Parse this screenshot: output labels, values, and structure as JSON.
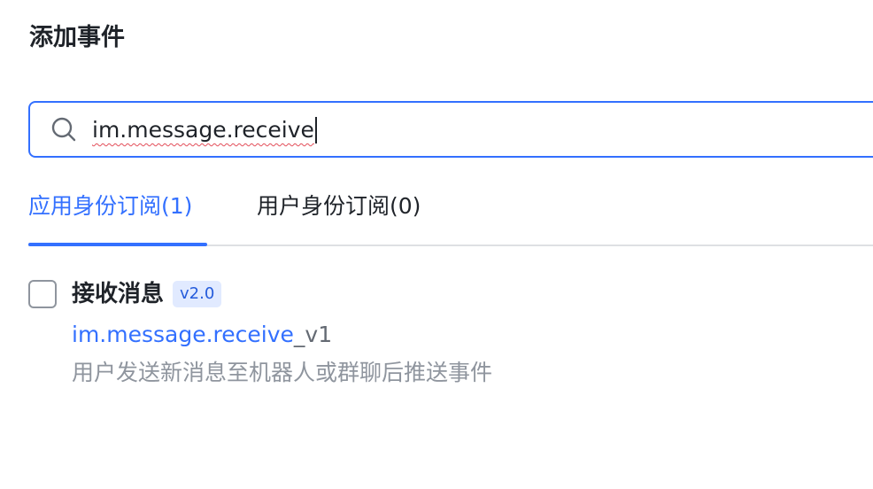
{
  "dialog": {
    "title": "添加事件"
  },
  "search": {
    "value": "im.message.receive",
    "icon": "search-icon"
  },
  "tabs": [
    {
      "label": "应用身份订阅(1)",
      "active": true
    },
    {
      "label": "用户身份订阅(0)",
      "active": false
    }
  ],
  "events": [
    {
      "name": "接收消息",
      "version": "v2.0",
      "key_match": "im.message.receive",
      "key_rest": "_v1",
      "description": "用户发送新消息至机器人或群聊后推送事件",
      "checked": false
    }
  ],
  "colors": {
    "accent": "#3370ff",
    "badge_bg": "#e1eaff",
    "muted": "#8f959e"
  }
}
